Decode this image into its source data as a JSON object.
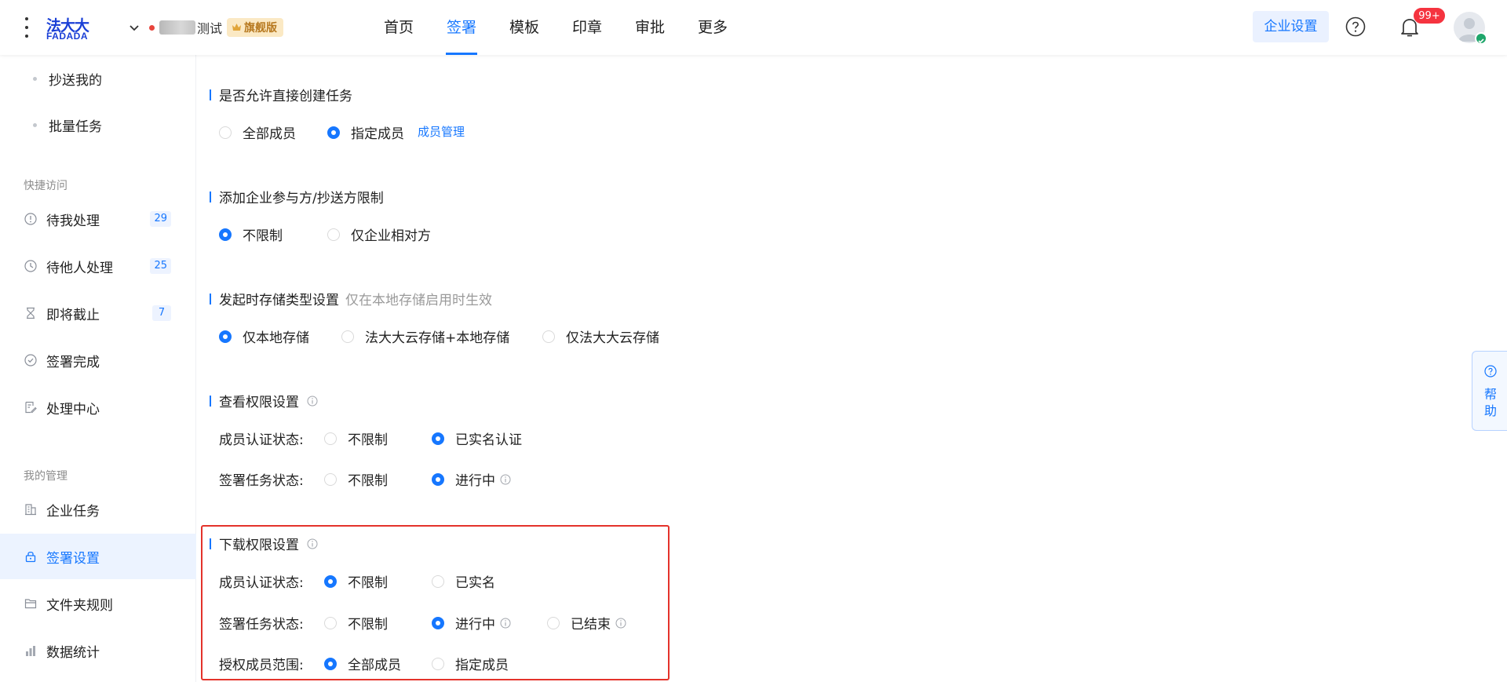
{
  "header": {
    "logo": {
      "cn": "法大大",
      "en": "FADADA"
    },
    "org": {
      "name_suffix": "测试",
      "edition": "旗舰版"
    },
    "nav": [
      {
        "label": "首页",
        "active": false
      },
      {
        "label": "签署",
        "active": true
      },
      {
        "label": "模板",
        "active": false
      },
      {
        "label": "印章",
        "active": false
      },
      {
        "label": "审批",
        "active": false
      },
      {
        "label": "更多",
        "active": false
      }
    ],
    "enterprise_settings": "企业设置",
    "notif_count": "99+"
  },
  "sidebar": {
    "sub_items": [
      "抄送我的",
      "批量任务"
    ],
    "quick_access_title": "快捷访问",
    "quick_access": [
      {
        "label": "待我处理",
        "count": "29",
        "icon": "alert-circle-icon"
      },
      {
        "label": "待他人处理",
        "count": "25",
        "icon": "clock-icon"
      },
      {
        "label": "即将截止",
        "count": "7",
        "icon": "hourglass-icon"
      },
      {
        "label": "签署完成",
        "count": "",
        "icon": "check-circle-icon"
      },
      {
        "label": "处理中心",
        "count": "",
        "icon": "edit-doc-icon"
      }
    ],
    "my_manage_title": "我的管理",
    "my_manage": [
      {
        "label": "企业任务",
        "icon": "building-icon",
        "active": false
      },
      {
        "label": "签署设置",
        "icon": "lock-icon",
        "active": true
      },
      {
        "label": "文件夹规则",
        "icon": "folder-icon",
        "active": false
      },
      {
        "label": "数据统计",
        "icon": "bar-chart-icon",
        "active": false
      }
    ]
  },
  "settings": {
    "create_task": {
      "title": "是否允许直接创建任务",
      "options": [
        "全部成员",
        "指定成员"
      ],
      "selected": 1,
      "link": "成员管理"
    },
    "participant_limit": {
      "title": "添加企业参与方/抄送方限制",
      "options": [
        "不限制",
        "仅企业相对方"
      ],
      "selected": 0
    },
    "storage_type": {
      "title": "发起时存储类型设置",
      "note": "仅在本地存储启用时生效",
      "options": [
        "仅本地存储",
        "法大大云存储+本地存储",
        "仅法大大云存储"
      ],
      "selected": 0
    },
    "view_permission": {
      "title": "查看权限设置",
      "member_label": "成员认证状态:",
      "member_options": [
        "不限制",
        "已实名认证"
      ],
      "member_selected": 1,
      "task_label": "签署任务状态:",
      "task_options": [
        "不限制",
        "进行中"
      ],
      "task_selected": 1
    },
    "download_permission": {
      "title": "下载权限设置",
      "member_label": "成员认证状态:",
      "member_options": [
        "不限制",
        "已实名"
      ],
      "member_selected": 0,
      "task_label": "签署任务状态:",
      "task_options": [
        "不限制",
        "进行中",
        "已结束"
      ],
      "task_selected": 1,
      "scope_label": "授权成员范围:",
      "scope_options": [
        "全部成员",
        "指定成员"
      ],
      "scope_selected": 0
    }
  },
  "help_float": "帮助",
  "colors": {
    "primary": "#1677ff",
    "highlight": "#e4332b",
    "badge": "#f5333f"
  }
}
